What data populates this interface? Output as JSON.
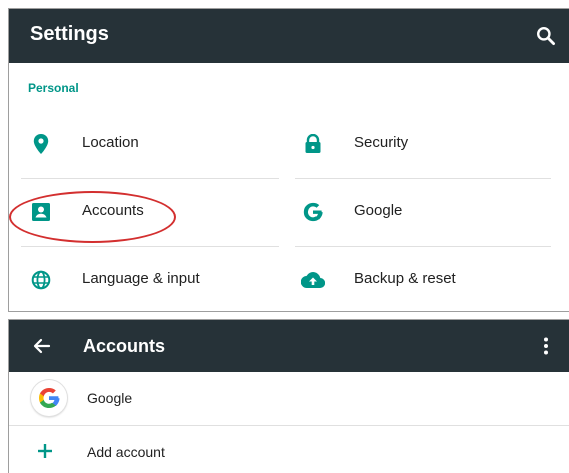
{
  "settings": {
    "title": "Settings",
    "section": "Personal",
    "items": [
      {
        "label": "Location",
        "icon": "location-pin-icon"
      },
      {
        "label": "Security",
        "icon": "lock-icon"
      },
      {
        "label": "Accounts",
        "icon": "account-box-icon"
      },
      {
        "label": "Google",
        "icon": "google-g-icon"
      },
      {
        "label": "Language & input",
        "icon": "globe-icon"
      },
      {
        "label": "Backup & reset",
        "icon": "cloud-upload-icon"
      }
    ]
  },
  "accounts": {
    "title": "Accounts",
    "rows": [
      {
        "label": "Google",
        "icon": "google-logo-icon"
      },
      {
        "label": "Add account",
        "icon": "plus-icon"
      }
    ]
  },
  "colors": {
    "app_bar": "#263238",
    "accent": "#009688",
    "highlight": "#d32f2f"
  }
}
